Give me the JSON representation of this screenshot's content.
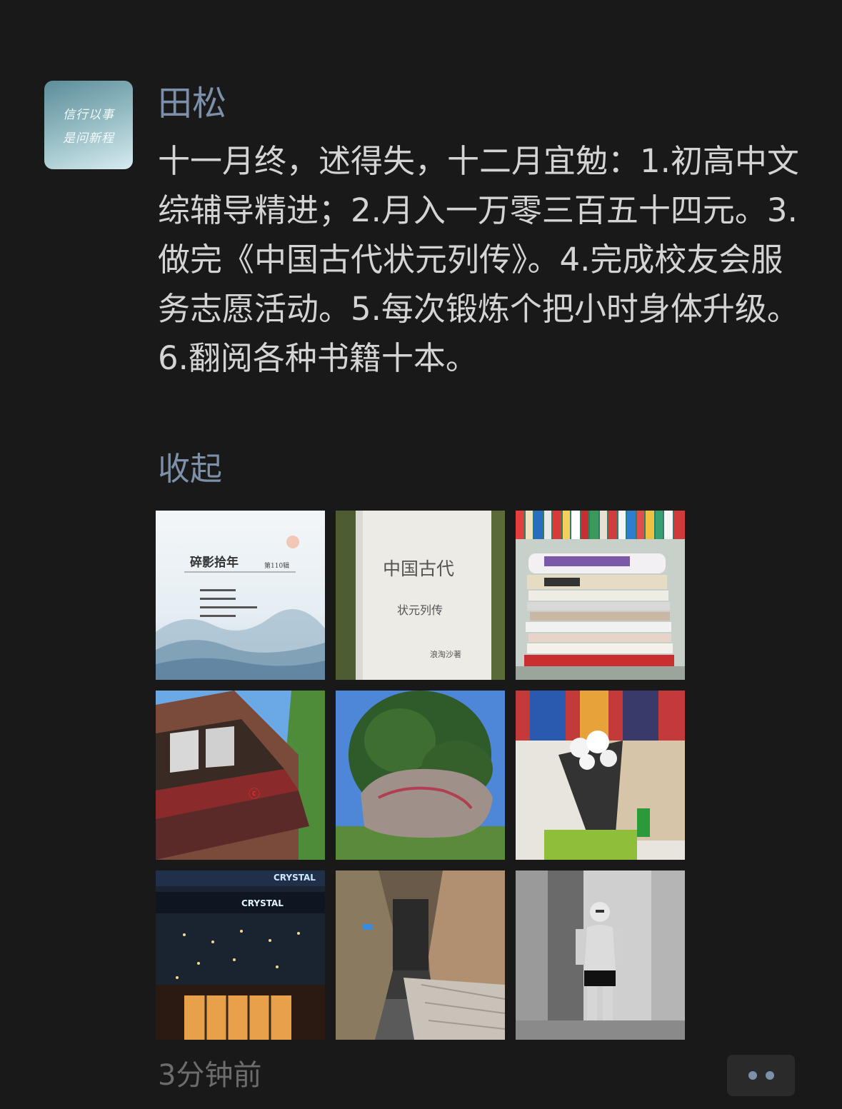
{
  "post": {
    "avatar_text": [
      "信行以事",
      "是问新程"
    ],
    "author": "田松",
    "content": "十一月终，述得失，十二月宜勉：1.初高中文综辅导精进；2.月入一万零三百五十四元。3.做完《中国古代状元列传》。4.完成校友会服务志愿活动。5.每次锻炼个把小时身体升级。6.翻阅各种书籍十本。",
    "collapse_label": "收起",
    "timestamp": "3分钟前",
    "photos": [
      {
        "name": "magazine-cover-photo",
        "text_lines": [
          "碎影拾年",
          "第110辑"
        ]
      },
      {
        "name": "book-manuscript-photo",
        "text_lines": [
          "中国古代",
          "状元列传",
          "浪淘沙著"
        ]
      },
      {
        "name": "book-stack-photo",
        "text_lines": []
      },
      {
        "name": "building-facade-photo",
        "text_lines": []
      },
      {
        "name": "tree-rock-photo",
        "text_lines": []
      },
      {
        "name": "flower-bouquet-photo",
        "text_lines": []
      },
      {
        "name": "crystal-hotel-night-photo",
        "text_lines": [
          "CRYSTAL"
        ]
      },
      {
        "name": "hotel-corridor-photo",
        "text_lines": []
      },
      {
        "name": "mirror-selfie-photo",
        "text_lines": []
      }
    ]
  },
  "colors": {
    "background": "#191919",
    "name_link": "#7d90a9",
    "body_text": "#d4d4d4",
    "timestamp": "#6c6c6c"
  }
}
